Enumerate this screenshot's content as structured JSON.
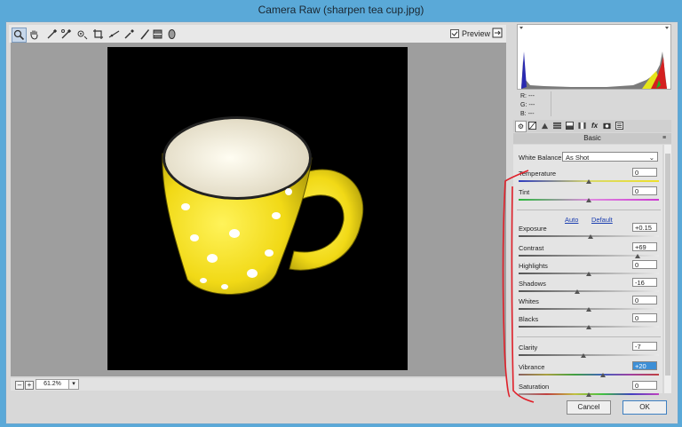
{
  "window": {
    "title": "Camera Raw (sharpen tea cup.jpg)",
    "minimize": "—",
    "maximize": "□",
    "close": "✕"
  },
  "toolbar": {
    "tools": [
      "zoom-icon",
      "hand-icon",
      "white-balance-icon",
      "color-sampler-icon",
      "targeted-adjustment-icon",
      "crop-icon",
      "straighten-icon",
      "spot-removal-icon",
      "red-eye-icon",
      "adjustment-brush-icon",
      "graduated-filter-icon",
      "radial-filter-icon"
    ],
    "preview_label": "Preview",
    "preview_checked": true,
    "fullscreen_icon": "fullscreen-icon"
  },
  "status": {
    "zoom_out": "–",
    "zoom_in": "+",
    "zoom_value": "61.2%",
    "zoom_dropdown": "▾"
  },
  "histogram": {
    "r_label": "R:",
    "r_value": "---",
    "g_label": "G:",
    "g_value": "---",
    "b_label": "B:",
    "b_value": "---"
  },
  "panel": {
    "tabs": [
      "basic-icon",
      "tone-curve-icon",
      "detail-icon",
      "hsl-icon",
      "split-toning-icon",
      "lens-icon",
      "fx-icon",
      "camera-calibration-icon",
      "presets-icon"
    ],
    "title": "Basic",
    "white_balance_label": "White Balance:",
    "white_balance_value": "As Shot",
    "auto_link": "Auto",
    "default_link": "Default",
    "sliders": [
      {
        "label": "Temperature",
        "value": "0",
        "level": 0.5
      },
      {
        "label": "Tint",
        "value": "0",
        "level": 0.5
      },
      {
        "label": "Exposure",
        "value": "+0.15",
        "level": 0.51
      },
      {
        "label": "Contrast",
        "value": "+69",
        "level": 0.85
      },
      {
        "label": "Highlights",
        "value": "0",
        "level": 0.5
      },
      {
        "label": "Shadows",
        "value": "-16",
        "level": 0.42
      },
      {
        "label": "Whites",
        "value": "0",
        "level": 0.5
      },
      {
        "label": "Blacks",
        "value": "0",
        "level": 0.5
      },
      {
        "label": "Clarity",
        "value": "-7",
        "level": 0.465
      },
      {
        "label": "Vibrance",
        "value": "+20",
        "level": 0.6
      },
      {
        "label": "Saturation",
        "value": "0",
        "level": 0.5
      }
    ]
  },
  "buttons": {
    "cancel": "Cancel",
    "ok": "OK"
  },
  "colors": {
    "accent": "#5aa9d8",
    "annotation": "#e0202a",
    "photo_bg": "#000000",
    "cup": "#f2dd1c"
  }
}
